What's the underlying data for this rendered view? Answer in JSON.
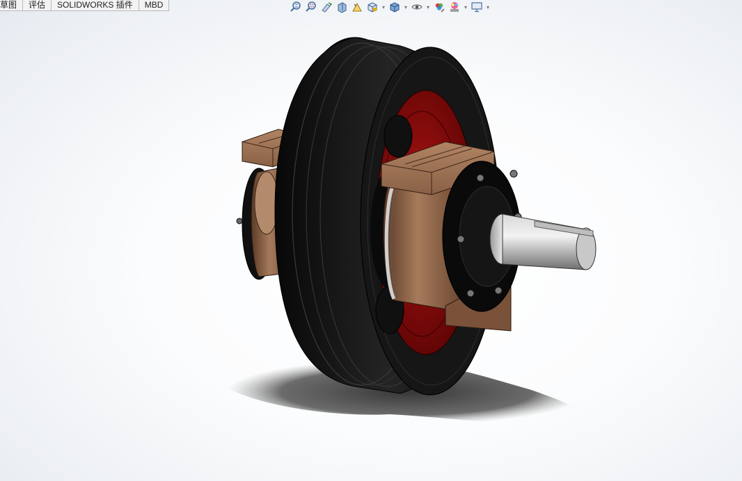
{
  "command_manager": {
    "tabs": [
      "草图",
      "评估",
      "SOLIDWORKS 插件",
      "MBD"
    ]
  },
  "heads_up_toolbar": {
    "buttons": [
      {
        "icon": "zoom-to-fit-icon",
        "dropdown": false
      },
      {
        "icon": "zoom-to-area-icon",
        "dropdown": false
      },
      {
        "icon": "previous-view-icon",
        "dropdown": false
      },
      {
        "icon": "section-view-icon",
        "dropdown": false
      },
      {
        "icon": "dynamic-annotation-views-icon",
        "dropdown": false
      },
      {
        "icon": "view-orientation-icon",
        "dropdown": true
      },
      {
        "icon": "display-style-icon",
        "dropdown": true
      },
      {
        "icon": "hide-show-items-icon",
        "dropdown": true
      },
      {
        "icon": "edit-appearance-icon",
        "dropdown": false
      },
      {
        "icon": "apply-scene-icon",
        "dropdown": true
      },
      {
        "icon": "view-settings-icon",
        "dropdown": true
      }
    ]
  },
  "model": {
    "description_colors": {
      "tire": "#1c1c1c",
      "rim_inner": "#8a0a0a",
      "bearing_housing": "#8a6146",
      "shaft": "#9b9b9b",
      "end_cap": "#0d0d0d"
    }
  }
}
